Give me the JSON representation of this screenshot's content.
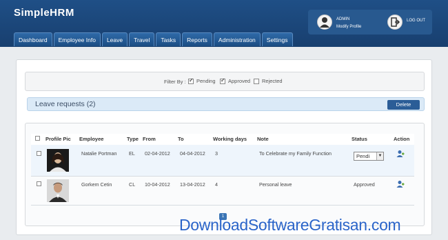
{
  "app": {
    "title": "SimpleHRM",
    "user": {
      "name": "ADMIN",
      "modify_label": "Modify Profile"
    },
    "logout_label": "LOG OUT"
  },
  "nav": {
    "tabs": [
      "Dashboard",
      "Employee Info",
      "Leave",
      "Travel",
      "Tasks",
      "Reports",
      "Administration",
      "Settings"
    ]
  },
  "filter": {
    "label": "Filter By :",
    "options": [
      {
        "label": "Pending",
        "checked": true
      },
      {
        "label": "Approved",
        "checked": true
      },
      {
        "label": "Rejected",
        "checked": false
      }
    ]
  },
  "leave": {
    "title": "Leave requests (2)",
    "delete_label": "Delete"
  },
  "table": {
    "headers": [
      "Profile Pic",
      "Employee",
      "Type",
      "From",
      "To",
      "Working days",
      "Note",
      "Status",
      "Action"
    ],
    "rows": [
      {
        "employee": "Natalie Portman",
        "type": "EL",
        "from": "02-04-2012",
        "to": "04-04-2012",
        "days": "3",
        "note": "To Celebrate my Family Function",
        "status": "Pendi"
      },
      {
        "employee": "Gorkem Cetin",
        "type": "CL",
        "from": "10-04-2012",
        "to": "13-04-2012",
        "days": "4",
        "note": "Personal leave",
        "status": "Approved"
      }
    ]
  },
  "pager": {
    "current": "1"
  },
  "watermark": "DownloadSoftwareGratisan.com",
  "colors": {
    "header": "#1f4f86",
    "accent": "#2b5d97",
    "watermark": "#2a64c9"
  },
  "icons": [
    "user-icon",
    "logout-icon",
    "checkbox-icon",
    "user-edit-icon"
  ]
}
